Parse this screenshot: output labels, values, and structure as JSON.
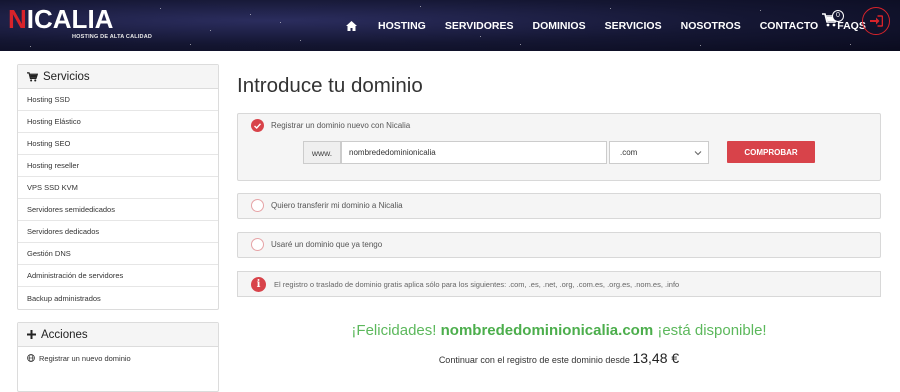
{
  "header": {
    "logo_prefix": "N",
    "logo_main": "ICALIA",
    "logo_tagline": "HOSTING DE ALTA CALIDAD",
    "nav": [
      "HOSTING",
      "SERVIDORES",
      "DOMINIOS",
      "SERVICIOS",
      "NOSOTROS",
      "CONTACTO",
      "FAQS"
    ],
    "cart_count": "0",
    "home_icon": "home-icon",
    "cart_icon": "cart-icon",
    "login_icon": "login-icon"
  },
  "sidebar": {
    "services": {
      "title": "Servicios",
      "items": [
        "Hosting SSD",
        "Hosting Elástico",
        "Hosting SEO",
        "Hosting reseller",
        "VPS SSD KVM",
        "Servidores semidedicados",
        "Servidores dedicados",
        "Gestión DNS",
        "Administración de servidores",
        "Backup administrados"
      ]
    },
    "actions": {
      "title": "Acciones",
      "items": [
        "Registrar un nuevo dominio"
      ]
    }
  },
  "main": {
    "title": "Introduce tu dominio",
    "option_register": "Registrar un dominio nuevo con Nicalia",
    "www_label": "www.",
    "domain_value": "nombrededominionicalia",
    "tld_value": ".com",
    "check_button": "COMPROBAR",
    "option_transfer": "Quiero transferir mi dominio a Nicalia",
    "option_existing": "Usaré un dominio que ya tengo",
    "info_text": "El registro o traslado de dominio gratis aplica sólo para los siguientes: .com, .es, .net, .org, .com.es, .org.es, .nom.es, .info",
    "congrats_prefix": "¡Felicidades!",
    "congrats_domain": "nombrededominionicalia.com",
    "congrats_suffix": "¡está disponible!",
    "continue_text": "Continuar con el registro de este dominio desde",
    "price": "13,48 €"
  },
  "colors": {
    "accent": "#d8434a",
    "success": "#5cb85c",
    "header_bg": "#141632"
  }
}
